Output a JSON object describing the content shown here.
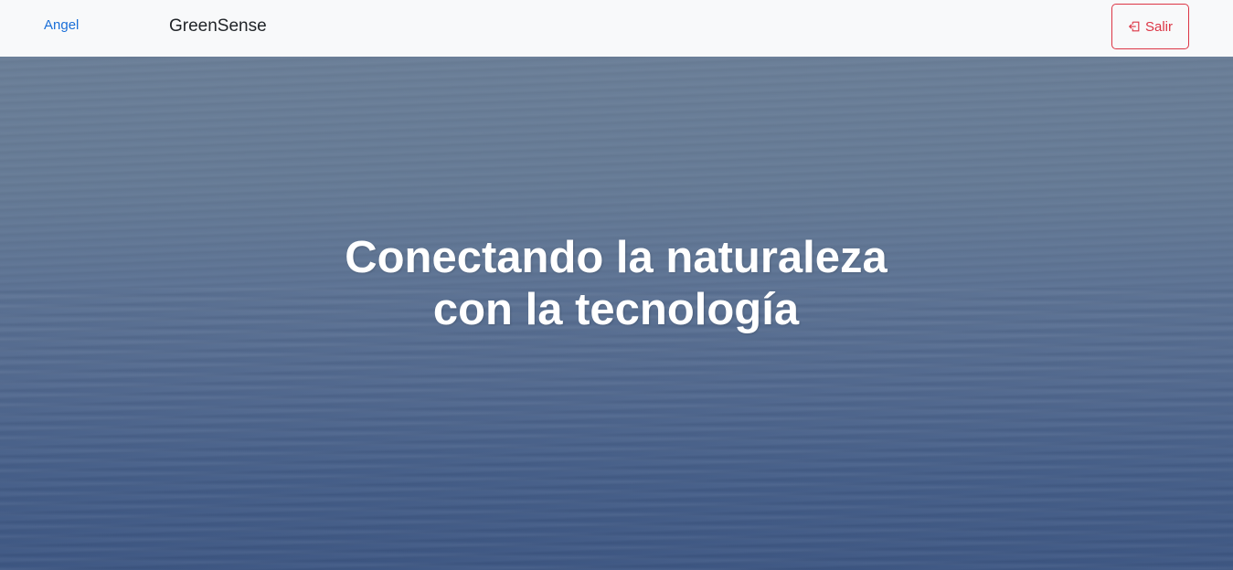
{
  "navbar": {
    "user_name": "Angel",
    "brand": "GreenSense",
    "logout_label": "Salir",
    "logout_icon": "box-arrow-left-icon"
  },
  "hero": {
    "headline": "Conectando la naturaleza con la tecnología",
    "background": "ocean-water-image"
  },
  "colors": {
    "navbar_bg": "#f8f9fa",
    "link": "#1a6fd8",
    "danger": "#dc3545",
    "hero_text": "#ffffff"
  }
}
